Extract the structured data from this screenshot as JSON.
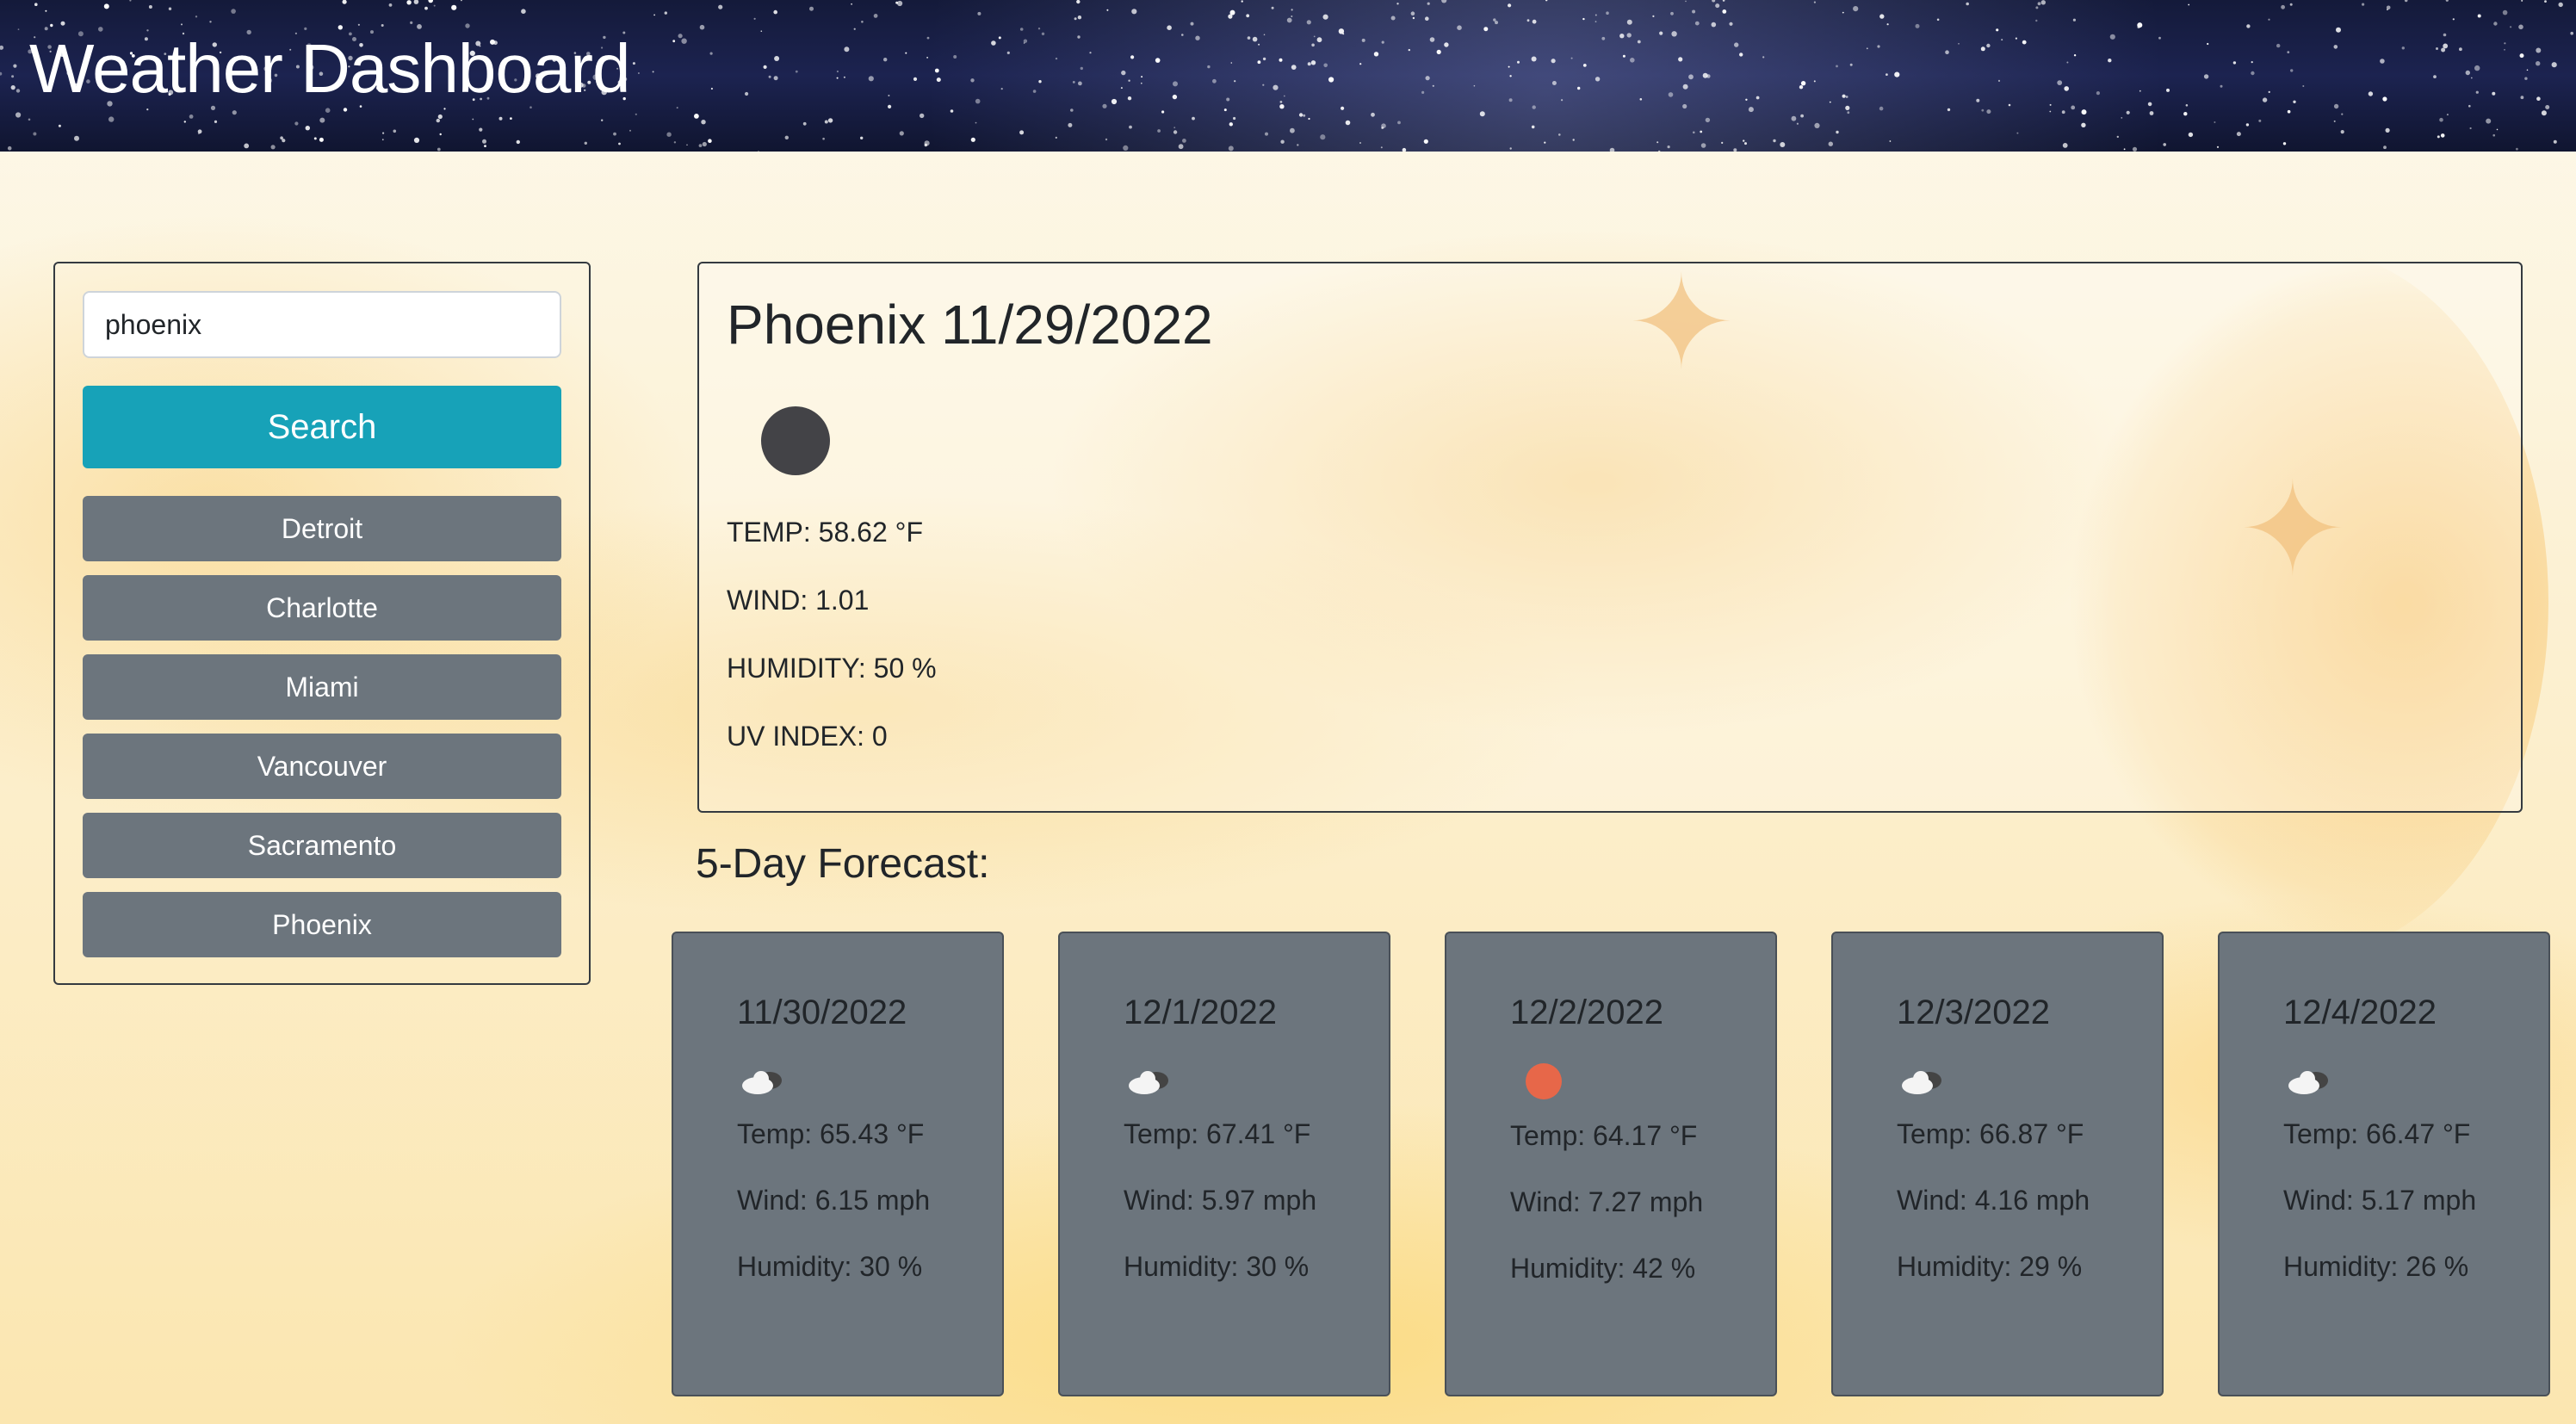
{
  "header": {
    "title": "Weather Dashboard"
  },
  "search": {
    "value": "phoenix",
    "button_label": "Search"
  },
  "history": [
    "Detroit",
    "Charlotte",
    "Miami",
    "Vancouver",
    "Sacramento",
    "Phoenix"
  ],
  "current": {
    "heading": "Phoenix 11/29/2022",
    "icon": "moon-icon",
    "temp": "TEMP: 58.62 °F",
    "wind": "WIND: 1.01",
    "humidity": "HUMIDITY: 50 %",
    "uv": "UV INDEX: 0"
  },
  "forecast": {
    "title": "5-Day Forecast:",
    "days": [
      {
        "date": "11/30/2022",
        "icon": "cloudy-icon",
        "temp": "Temp: 65.43 °F",
        "wind": "Wind: 6.15 mph",
        "humidity": "Humidity: 30 %"
      },
      {
        "date": "12/1/2022",
        "icon": "cloudy-icon",
        "temp": "Temp: 67.41 °F",
        "wind": "Wind: 5.97 mph",
        "humidity": "Humidity: 30 %"
      },
      {
        "date": "12/2/2022",
        "icon": "sun-icon",
        "temp": "Temp: 64.17 °F",
        "wind": "Wind: 7.27 mph",
        "humidity": "Humidity: 42 %"
      },
      {
        "date": "12/3/2022",
        "icon": "cloudy-icon",
        "temp": "Temp: 66.87 °F",
        "wind": "Wind: 4.16 mph",
        "humidity": "Humidity: 29 %"
      },
      {
        "date": "12/4/2022",
        "icon": "cloudy-icon",
        "temp": "Temp: 66.47 °F",
        "wind": "Wind: 5.17 mph",
        "humidity": "Humidity: 26 %"
      }
    ]
  },
  "colors": {
    "accent": "#17a2b8",
    "button_gray": "#6c757d",
    "sun": "#e76749"
  }
}
